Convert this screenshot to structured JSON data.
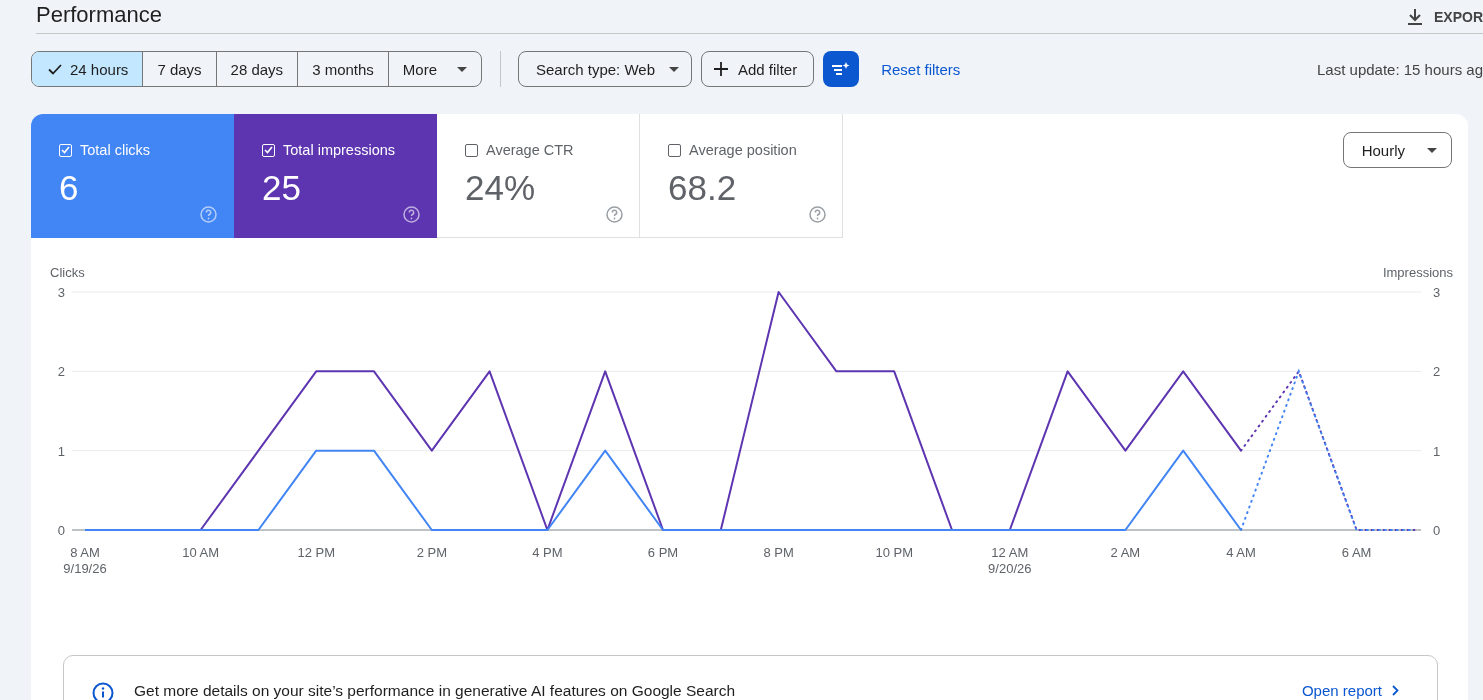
{
  "header": {
    "title": "Performance",
    "export_label": "EXPOR"
  },
  "toolbar": {
    "ranges": [
      {
        "label": "24 hours",
        "selected": true,
        "kind": "option"
      },
      {
        "label": "7 days",
        "selected": false,
        "kind": "option"
      },
      {
        "label": "28 days",
        "selected": false,
        "kind": "option"
      },
      {
        "label": "3 months",
        "selected": false,
        "kind": "option"
      },
      {
        "label": "More",
        "selected": false,
        "kind": "dropdown"
      }
    ],
    "search_type": "Search type: Web",
    "add_filter": "Add filter",
    "reset_filters": "Reset filters",
    "last_update": "Last update: 15 hours ag"
  },
  "metrics": [
    {
      "label": "Total clicks",
      "value": "6",
      "checked": true,
      "color": "#4285f4"
    },
    {
      "label": "Total impressions",
      "value": "25",
      "checked": true,
      "color": "#5e35b1"
    },
    {
      "label": "Average CTR",
      "value": "24%",
      "checked": false
    },
    {
      "label": "Average position",
      "value": "68.2",
      "checked": false
    }
  ],
  "granularity": "Hourly",
  "chart": {
    "right_axis": {
      "title": "Impressions",
      "ticks": [
        "3",
        "2",
        "1",
        "0"
      ]
    },
    "chart_data": {
      "type": "line",
      "categories": [
        "8 AM\n9/19/26",
        null,
        "10 AM",
        null,
        "12 PM",
        null,
        "2 PM",
        null,
        "4 PM",
        null,
        "6 PM",
        null,
        "8 PM",
        null,
        "10 PM",
        null,
        "12 AM\n9/20/26",
        null,
        "2 AM",
        null,
        "4 AM",
        null,
        "6 AM",
        null
      ],
      "ylabel": "Clicks",
      "ylim": [
        0,
        3
      ],
      "yticks": [
        0,
        1,
        2,
        3
      ],
      "series": [
        {
          "color": "#5e35b1",
          "values": [
            0,
            0,
            0,
            1,
            2,
            2,
            1,
            2,
            0,
            2,
            0,
            0,
            3,
            2,
            2,
            0,
            0,
            2,
            1,
            2,
            1,
            null,
            null,
            null
          ]
        },
        {
          "color": "#4285f4",
          "values": [
            0,
            0,
            0,
            0,
            1,
            1,
            0,
            0,
            0,
            1,
            0,
            0,
            0,
            0,
            0,
            0,
            0,
            0,
            0,
            1,
            0,
            null,
            null,
            null
          ]
        },
        {
          "color": "#5e35b1",
          "line_style": "dotted",
          "values": [
            null,
            null,
            null,
            null,
            null,
            null,
            null,
            null,
            null,
            null,
            null,
            null,
            null,
            null,
            null,
            null,
            null,
            null,
            null,
            null,
            1,
            2,
            0,
            0
          ]
        },
        {
          "color": "#4285f4",
          "line_style": "dotted",
          "values": [
            null,
            null,
            null,
            null,
            null,
            null,
            null,
            null,
            null,
            null,
            null,
            null,
            null,
            null,
            null,
            null,
            null,
            null,
            null,
            null,
            0,
            2,
            0,
            0
          ]
        }
      ]
    }
  },
  "banner": {
    "text": "Get more details on your site’s performance in generative AI features on Google Search",
    "link": "Open report"
  }
}
